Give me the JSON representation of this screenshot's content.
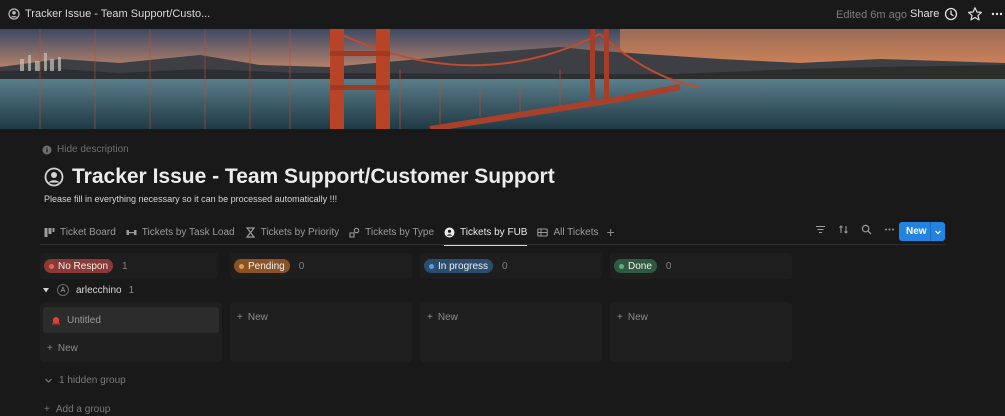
{
  "window": {
    "tab_title": "Tracker Issue - Team Support/Custo...",
    "edited": "Edited 6m ago",
    "share_label": "Share",
    "icons": [
      "page-icon",
      "clock-icon",
      "star-icon",
      "more-icon"
    ]
  },
  "page": {
    "hide_description": "Hide description",
    "title": "Tracker Issue - Team Support/Customer Support",
    "description": "Please fill in everything necessary so it can be processed automatically !!!"
  },
  "views": {
    "tabs": [
      {
        "label": "Ticket Board",
        "icon": "board-icon",
        "active": false
      },
      {
        "label": "Tickets by Task Load",
        "icon": "dumbbell-icon",
        "active": false
      },
      {
        "label": "Tickets by Priority",
        "icon": "hourglass-icon",
        "active": false
      },
      {
        "label": "Tickets by Type",
        "icon": "shapes-icon",
        "active": false
      },
      {
        "label": "Tickets by FUB",
        "icon": "person-icon",
        "active": true
      },
      {
        "label": "All Tickets",
        "icon": "table-icon",
        "active": false
      }
    ],
    "add_view": "+",
    "new_button": "New"
  },
  "board": {
    "columns": [
      {
        "label": "No Respon",
        "count": "1",
        "color": "#8a3a36",
        "dot": "#e0675f"
      },
      {
        "label": "Pending",
        "count": "0",
        "color": "#8a5325",
        "dot": "#e59b56"
      },
      {
        "label": "In progress",
        "count": "0",
        "color": "#2c4d6e",
        "dot": "#5a9fe0"
      },
      {
        "label": "Done",
        "count": "0",
        "color": "#2f5a3f",
        "dot": "#5fb07a"
      }
    ],
    "group": {
      "avatar_letter": "A",
      "name": "arlecchino",
      "count": "1"
    },
    "card": {
      "title": "Untitled",
      "icon": "siren-icon"
    },
    "add_new": "New",
    "hidden_group": "1 hidden group",
    "add_group": "Add a group"
  },
  "colors": {
    "accent": "#2383e2",
    "background": "#191919"
  }
}
